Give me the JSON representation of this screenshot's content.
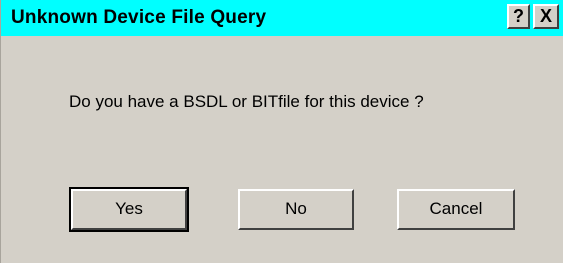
{
  "window": {
    "title": "Unknown Device File Query",
    "help_label": "?",
    "close_label": "X"
  },
  "message": "Do you have a BSDL or BITfile for this device ?",
  "buttons": {
    "yes": "Yes",
    "no": "No",
    "cancel": "Cancel"
  },
  "colors": {
    "titlebar": "#00ffff",
    "dialog_bg": "#d4d0c8"
  }
}
